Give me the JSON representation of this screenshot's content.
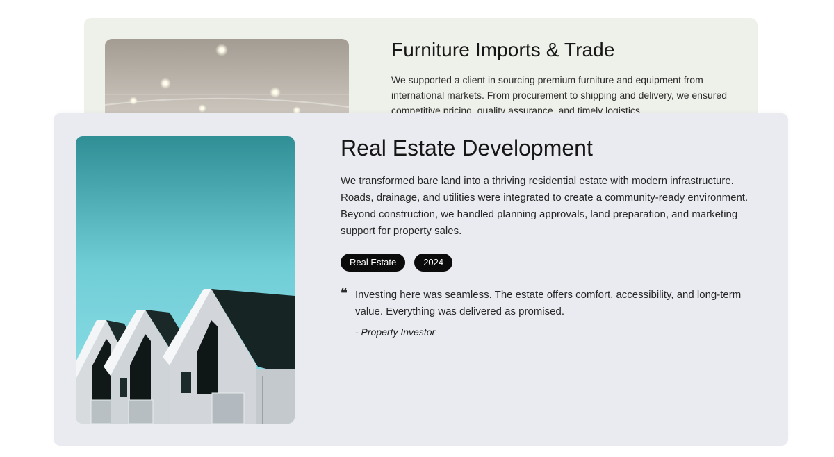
{
  "projects": [
    {
      "title": "Furniture Imports & Trade",
      "description": "We supported a client in sourcing premium furniture and equipment from international markets. From procurement to shipping and delivery, we ensured competitive pricing, quality assurance, and timely logistics.",
      "image_icon": "ceiling-lights-photo"
    },
    {
      "title": "Real Estate Development",
      "description": "We transformed bare land into a thriving residential estate with modern infrastructure. Roads, drainage, and utilities were integrated to create a community-ready environment. Beyond construction, we handled planning approvals, land preparation, and marketing support for property sales.",
      "tags": [
        "Real Estate",
        "2024"
      ],
      "quote": "Investing here was seamless. The estate offers comfort, accessibility, and long-term value. Everything was delivered as promised.",
      "author": "- Property Investor",
      "image_icon": "gabled-houses-photo"
    }
  ],
  "colors": {
    "back_card_bg": "#eef0ea",
    "front_card_bg": "#eaebf0",
    "tag_bg": "#0b0b0b",
    "sky_top": "#2f8f95",
    "sky_bottom": "#8fdde6"
  }
}
